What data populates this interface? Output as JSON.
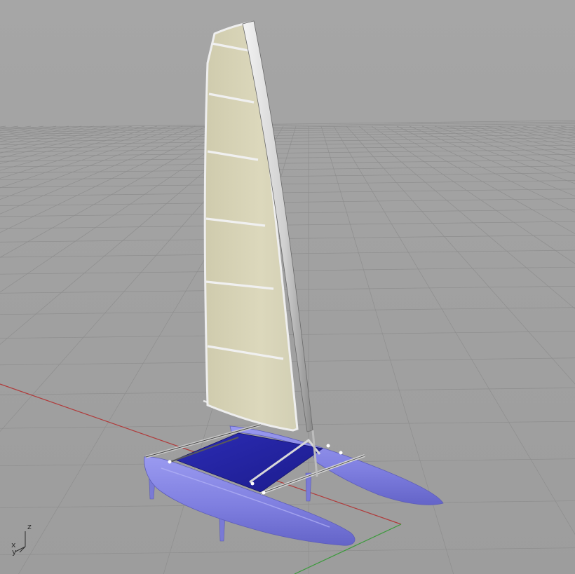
{
  "viewport": {
    "view": "perspective",
    "grid_visible": true,
    "colors": {
      "background": "#a3a3a3",
      "grid_line": "#8e8e8e",
      "x_axis": "#b03a3a",
      "y_axis": "#3a9a3a",
      "sail": "#d8d4b6",
      "sail_batten": "#f2f2f2",
      "mast": "#dcdcdc",
      "hull": "#8c8ce6",
      "trampoline": "#2323a0"
    }
  },
  "axis_widget": {
    "z_label": "z",
    "x_label": "x",
    "y_label": "y"
  },
  "model": {
    "parts": [
      "sail-icon",
      "mast-icon",
      "hull-icon",
      "trampoline-icon",
      "crossbeam-icon",
      "daggerboard-icon"
    ]
  }
}
